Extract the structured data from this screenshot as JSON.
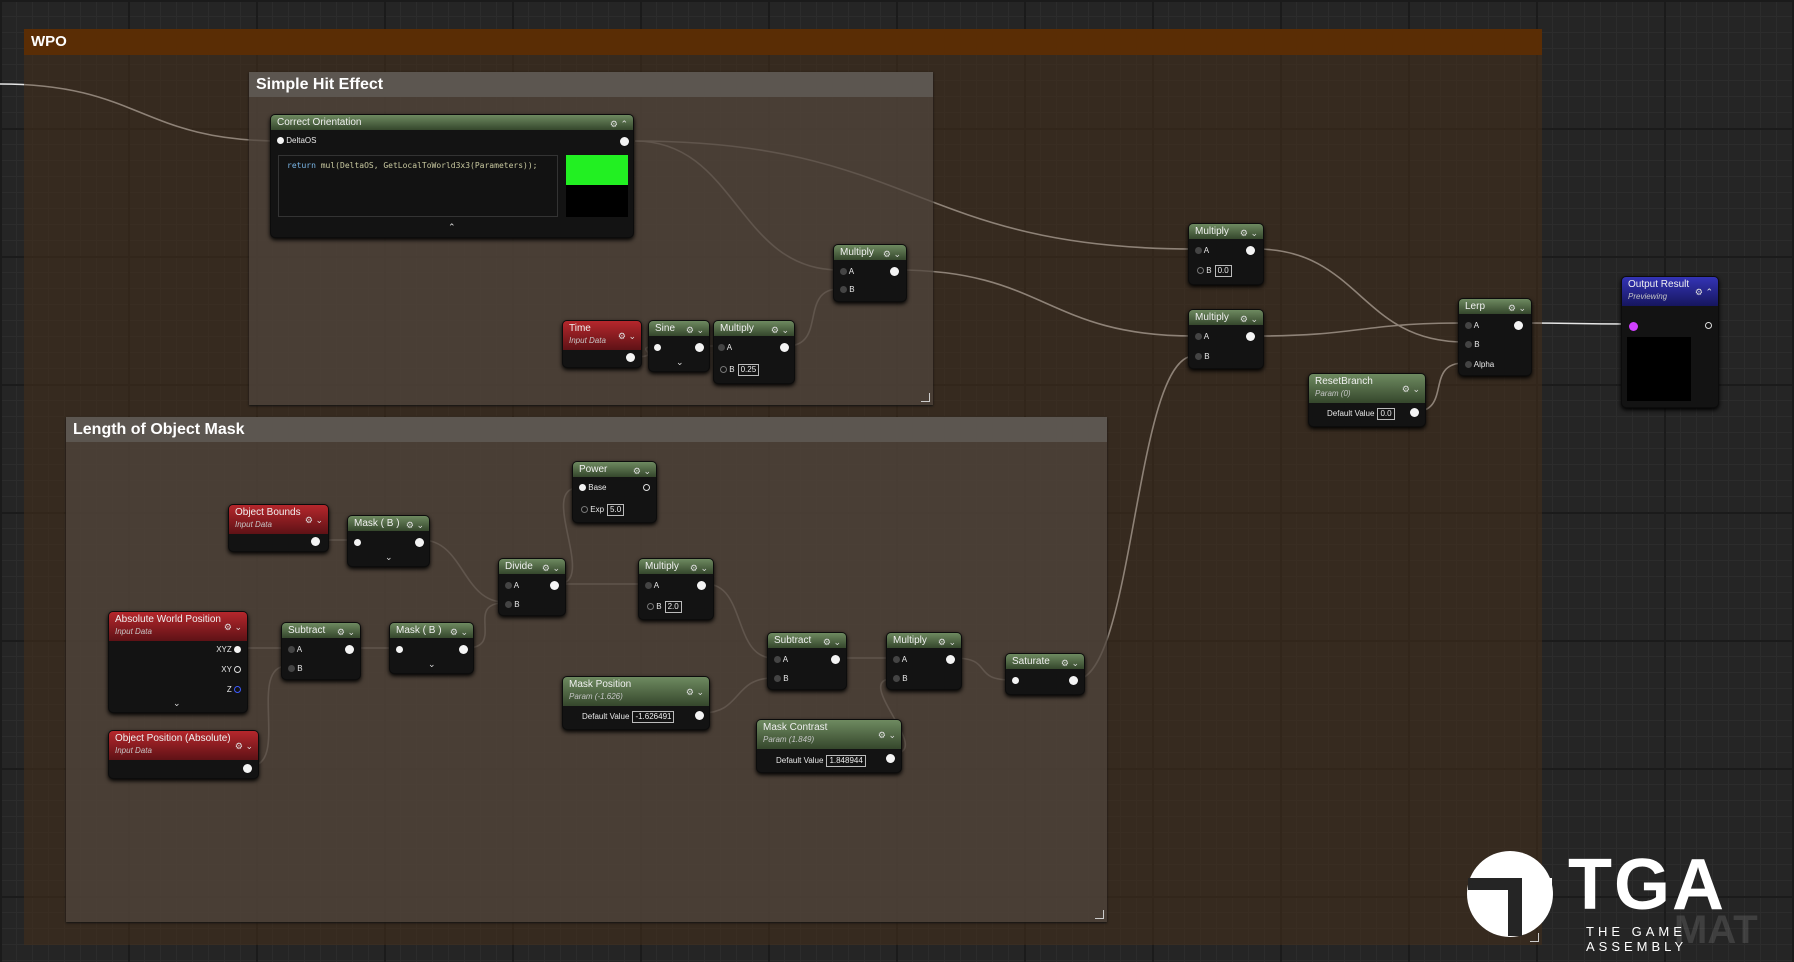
{
  "comments": {
    "wpo": "WPO",
    "hit": "Simple Hit Effect",
    "mask": "Length of Object Mask"
  },
  "nodes": {
    "correct_orientation": {
      "title": "Correct Orientation",
      "pin_in": "DeltaOS",
      "code_kw": "return",
      "code": "mul(DeltaOS, GetLocalToWorld3x3(Parameters));",
      "swatch_color": "#22f022"
    },
    "multiply_top_right": {
      "title": "Multiply",
      "pin_a": "A",
      "pin_b": "B",
      "b_value": "0.0"
    },
    "multiply_mid_right": {
      "title": "Multiply",
      "pin_a": "A",
      "pin_b": "B"
    },
    "multiply_hit": {
      "title": "Multiply",
      "pin_a": "A",
      "pin_b": "B"
    },
    "time": {
      "title": "Time",
      "sub": "Input Data"
    },
    "sine": {
      "title": "Sine"
    },
    "multiply_sine": {
      "title": "Multiply",
      "pin_a": "A",
      "pin_b": "B",
      "b_value": "0.25"
    },
    "lerp": {
      "title": "Lerp",
      "pin_a": "A",
      "pin_b": "B",
      "pin_alpha": "Alpha"
    },
    "reset_branch": {
      "title": "ResetBranch",
      "sub": "Param (0)",
      "label": "Default Value",
      "value": "0.0"
    },
    "output_result": {
      "title": "Output Result",
      "sub": "Previewing"
    },
    "power": {
      "title": "Power",
      "pin_base": "Base",
      "pin_exp": "Exp",
      "exp_value": "5.0"
    },
    "object_bounds": {
      "title": "Object Bounds",
      "sub": "Input Data"
    },
    "mask_b_top": {
      "title": "Mask ( B )"
    },
    "divide": {
      "title": "Divide",
      "pin_a": "A",
      "pin_b": "B"
    },
    "multiply_mask": {
      "title": "Multiply",
      "pin_a": "A",
      "pin_b": "B",
      "b_value": "2.0"
    },
    "abs_world_pos": {
      "title": "Absolute World Position",
      "sub": "Input Data",
      "pin_xyz": "XYZ",
      "pin_xy": "XY",
      "pin_z": "Z"
    },
    "subtract_1": {
      "title": "Subtract",
      "pin_a": "A",
      "pin_b": "B"
    },
    "mask_b_bottom": {
      "title": "Mask ( B )"
    },
    "object_position": {
      "title": "Object Position (Absolute)",
      "sub": "Input Data"
    },
    "mask_position": {
      "title": "Mask Position",
      "sub": "Param (-1.626)",
      "label": "Default Value",
      "value": "-1.626491"
    },
    "subtract_2": {
      "title": "Subtract",
      "pin_a": "A",
      "pin_b": "B"
    },
    "multiply_contrast": {
      "title": "Multiply",
      "pin_a": "A",
      "pin_b": "B"
    },
    "mask_contrast": {
      "title": "Mask Contrast",
      "sub": "Param (1.849)",
      "label": "Default Value",
      "value": "1.848944"
    },
    "saturate": {
      "title": "Saturate"
    }
  },
  "logo": {
    "name": "TGA",
    "tagline": "THE GAME ASSEMBLY",
    "watermark": "MAT"
  },
  "colors": {
    "wire": "#e6e6e6",
    "section_header": "#5a2d05",
    "param_header": "#35472c",
    "input_header": "#b5272c",
    "output_header": "#3434b5"
  }
}
